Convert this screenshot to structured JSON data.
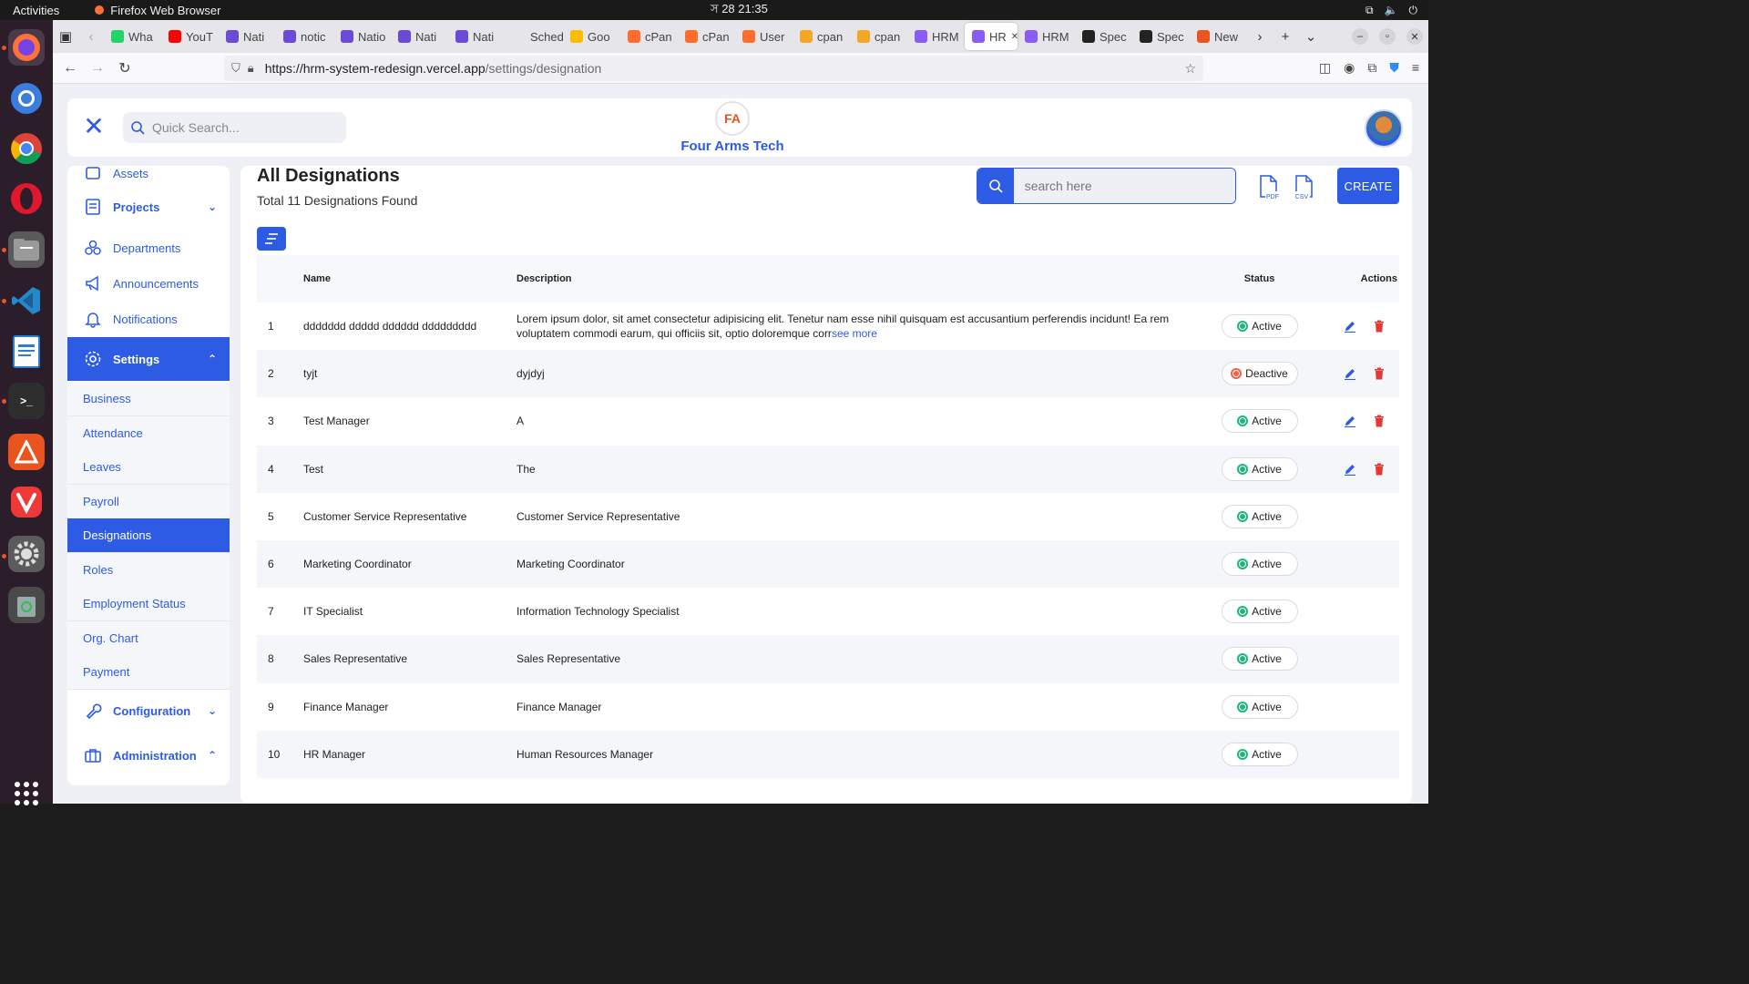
{
  "os": {
    "activities": "Activities",
    "app_name": "Firefox Web Browser",
    "clock": "স 28  21:35"
  },
  "browser": {
    "tabs": [
      {
        "label": "Wha",
        "color": "#25d366"
      },
      {
        "label": "YouT",
        "color": "#ff0000"
      },
      {
        "label": "Nati",
        "color": "#6b4bd6"
      },
      {
        "label": "notic",
        "color": "#6b4bd6"
      },
      {
        "label": "Natio",
        "color": "#6b4bd6"
      },
      {
        "label": "Nati",
        "color": "#6b4bd6"
      },
      {
        "label": "Nati",
        "color": "#6b4bd6"
      },
      {
        "label": "Schedul",
        "color": "#e6e6ea"
      },
      {
        "label": "Goo",
        "color": "#fbbc04"
      },
      {
        "label": "cPan",
        "color": "#ff6c2c"
      },
      {
        "label": "cPan",
        "color": "#ff6c2c"
      },
      {
        "label": "User",
        "color": "#ff6c2c"
      },
      {
        "label": "cpan",
        "color": "#f5a623"
      },
      {
        "label": "cpan",
        "color": "#f5a623"
      },
      {
        "label": "HRM",
        "color": "#8a5cf6"
      },
      {
        "label": "HR",
        "color": "#8a5cf6",
        "active": true
      },
      {
        "label": "HRM",
        "color": "#8a5cf6"
      },
      {
        "label": "Spec",
        "color": "#222222"
      },
      {
        "label": "Spec",
        "color": "#222222"
      },
      {
        "label": "New",
        "color": "#e95420"
      }
    ],
    "url_host": "https://hrm-system-redesign.vercel.app",
    "url_path": "/settings/designation"
  },
  "header": {
    "quick_search_placeholder": "Quick Search...",
    "brand": "Four Arms Tech",
    "logo_text": "FA"
  },
  "sidebar": {
    "assets": "Assets",
    "projects": "Projects",
    "departments": "Departments",
    "announcements": "Announcements",
    "notifications": "Notifications",
    "settings": "Settings",
    "settings_sub": [
      "Business",
      "Attendance",
      "Leaves",
      "Payroll",
      "Designations",
      "Roles",
      "Employment Status",
      "Org. Chart",
      "Payment"
    ],
    "configuration": "Configuration",
    "administration": "Administration"
  },
  "main": {
    "title": "All Designations",
    "count_text": "Total 11 Designations Found",
    "search_placeholder": "search here",
    "pdf_label": "PDF",
    "csv_label": "CSV",
    "create_label": "CREATE",
    "columns": {
      "name": "Name",
      "description": "Description",
      "status": "Status",
      "actions": "Actions"
    },
    "see_more": "see more",
    "rows": [
      {
        "idx": "1",
        "name": "ddddddd ddddd dddddd ddddddddd",
        "desc": "Lorem ipsum dolor, sit amet consectetur adipisicing elit. Tenetur nam esse nihil quisquam est accusantium perferendis incidunt! Ea rem voluptatem commodi earum, qui officiis sit, optio doloremque corr",
        "status": "Active",
        "actions": true
      },
      {
        "idx": "2",
        "name": "tyjt",
        "desc": "dyjdyj",
        "status": "Deactive",
        "actions": true
      },
      {
        "idx": "3",
        "name": "Test Manager",
        "desc": "A",
        "status": "Active",
        "actions": true
      },
      {
        "idx": "4",
        "name": "Test",
        "desc": "The",
        "status": "Active",
        "actions": true
      },
      {
        "idx": "5",
        "name": "Customer Service Representative",
        "desc": "Customer Service Representative",
        "status": "Active",
        "actions": false
      },
      {
        "idx": "6",
        "name": "Marketing Coordinator",
        "desc": "Marketing Coordinator",
        "status": "Active",
        "actions": false
      },
      {
        "idx": "7",
        "name": "IT Specialist",
        "desc": "Information Technology Specialist",
        "status": "Active",
        "actions": false
      },
      {
        "idx": "8",
        "name": "Sales Representative",
        "desc": "Sales Representative",
        "status": "Active",
        "actions": false
      },
      {
        "idx": "9",
        "name": "Finance Manager",
        "desc": "Finance Manager",
        "status": "Active",
        "actions": false
      },
      {
        "idx": "10",
        "name": "HR Manager",
        "desc": "Human Resources Manager",
        "status": "Active",
        "actions": false
      }
    ]
  },
  "colors": {
    "accent": "#2d5be3",
    "active_green": "#1fb67a",
    "deactive_red": "#f0604a",
    "delete_red": "#e53935"
  }
}
